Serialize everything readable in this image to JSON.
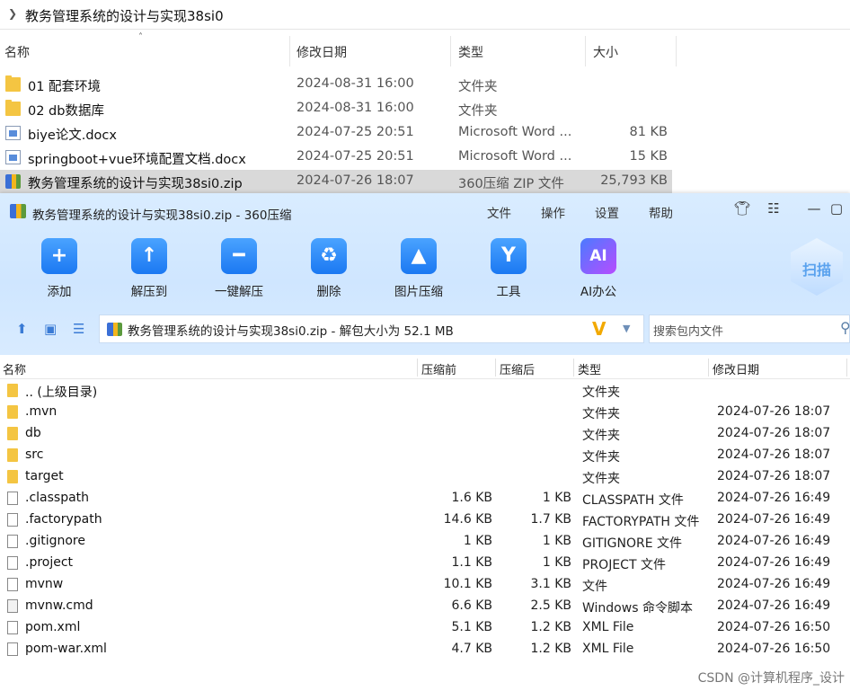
{
  "explorer": {
    "path": "教务管理系统的设计与实现38si0",
    "columns": {
      "name": "名称",
      "modified": "修改日期",
      "type": "类型",
      "size": "大小"
    },
    "rows": [
      {
        "name": "01 配套环境",
        "date": "2024-08-31 16:00",
        "type": "文件夹",
        "size": "",
        "icon": "folder-icon"
      },
      {
        "name": "02 db数据库",
        "date": "2024-08-31 16:00",
        "type": "文件夹",
        "size": "",
        "icon": "folder-icon"
      },
      {
        "name": "biye论文.docx",
        "date": "2024-07-25 20:51",
        "type": "Microsoft Word ...",
        "size": "81 KB",
        "icon": "word-document-icon"
      },
      {
        "name": "springboot+vue环境配置文档.docx",
        "date": "2024-07-25 20:51",
        "type": "Microsoft Word ...",
        "size": "15 KB",
        "icon": "word-document-icon"
      },
      {
        "name": "教务管理系统的设计与实现38si0.zip",
        "date": "2024-07-26 18:07",
        "type": "360压缩 ZIP 文件",
        "size": "25,793 KB",
        "icon": "zip-archive-icon",
        "selected": true
      }
    ]
  },
  "zip_window": {
    "title": "教务管理系统的设计与实现38si0.zip - 360压缩",
    "menu": [
      "文件",
      "操作",
      "设置",
      "帮助"
    ],
    "toolbar": [
      {
        "label": "添加",
        "icon": "add-icon"
      },
      {
        "label": "解压到",
        "icon": "extract-to-icon"
      },
      {
        "label": "一键解压",
        "icon": "one-click-extract-icon"
      },
      {
        "label": "删除",
        "icon": "recycle-bin-icon"
      },
      {
        "label": "图片压缩",
        "icon": "image-compress-icon"
      },
      {
        "label": "工具",
        "icon": "tools-icon"
      },
      {
        "label": "AI办公",
        "icon": "ai-office-icon"
      }
    ],
    "scan_label": "扫描",
    "address": "教务管理系统的设计与实现38si0.zip - 解包大小为 52.1 MB",
    "search_placeholder": "搜索包内文件",
    "columns": {
      "name": "名称",
      "before": "压缩前",
      "after": "压缩后",
      "type": "类型",
      "modified": "修改日期"
    },
    "rows": [
      {
        "name": ".. (上级目录)",
        "before": "",
        "after": "",
        "type": "文件夹",
        "date": "",
        "icon": "folder-icon"
      },
      {
        "name": ".mvn",
        "before": "",
        "after": "",
        "type": "文件夹",
        "date": "2024-07-26 18:07",
        "icon": "folder-icon"
      },
      {
        "name": "db",
        "before": "",
        "after": "",
        "type": "文件夹",
        "date": "2024-07-26 18:07",
        "icon": "folder-icon"
      },
      {
        "name": "src",
        "before": "",
        "after": "",
        "type": "文件夹",
        "date": "2024-07-26 18:07",
        "icon": "folder-icon"
      },
      {
        "name": "target",
        "before": "",
        "after": "",
        "type": "文件夹",
        "date": "2024-07-26 18:07",
        "icon": "folder-icon"
      },
      {
        "name": ".classpath",
        "before": "1.6 KB",
        "after": "1 KB",
        "type": "CLASSPATH 文件",
        "date": "2024-07-26 16:49",
        "icon": "file-icon"
      },
      {
        "name": ".factorypath",
        "before": "14.6 KB",
        "after": "1.7 KB",
        "type": "FACTORYPATH 文件",
        "date": "2024-07-26 16:49",
        "icon": "file-icon"
      },
      {
        "name": ".gitignore",
        "before": "1 KB",
        "after": "1 KB",
        "type": "GITIGNORE 文件",
        "date": "2024-07-26 16:49",
        "icon": "file-icon"
      },
      {
        "name": ".project",
        "before": "1.1 KB",
        "after": "1 KB",
        "type": "PROJECT 文件",
        "date": "2024-07-26 16:49",
        "icon": "file-icon"
      },
      {
        "name": "mvnw",
        "before": "10.1 KB",
        "after": "3.1 KB",
        "type": "文件",
        "date": "2024-07-26 16:49",
        "icon": "file-icon"
      },
      {
        "name": "mvnw.cmd",
        "before": "6.6 KB",
        "after": "2.5 KB",
        "type": "Windows 命令脚本",
        "date": "2024-07-26 16:49",
        "icon": "cmd-script-icon"
      },
      {
        "name": "pom.xml",
        "before": "5.1 KB",
        "after": "1.2 KB",
        "type": "XML File",
        "date": "2024-07-26 16:50",
        "icon": "file-icon"
      },
      {
        "name": "pom-war.xml",
        "before": "4.7 KB",
        "after": "1.2 KB",
        "type": "XML File",
        "date": "2024-07-26 16:50",
        "icon": "file-icon"
      }
    ]
  },
  "watermark": "CSDN @计算机程序_设计"
}
